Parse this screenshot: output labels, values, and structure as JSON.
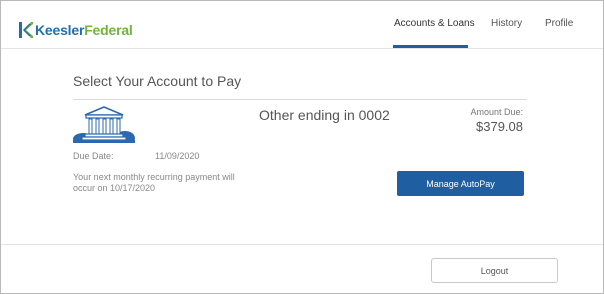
{
  "brand": {
    "name_part1": "Keesler",
    "name_part2": "Federal",
    "primary_color": "#1f6fae",
    "accent_color": "#6fb43f",
    "logo_icon": "keesler-logo-mark"
  },
  "nav": {
    "items": [
      {
        "label": "Accounts & Loans",
        "active": true
      },
      {
        "label": "History",
        "active": false
      },
      {
        "label": "Profile",
        "active": false
      }
    ],
    "active_color": "#1f5ea0"
  },
  "main": {
    "title": "Select Your Account to Pay",
    "account": {
      "icon": "bank-building-icon",
      "name": "Other ending in 0002",
      "amount_label": "Amount Due:",
      "amount": "$379.08",
      "due_label": "Due Date:",
      "due_date": "11/09/2020",
      "recurring_note": "Your next monthly recurring payment will occur on 10/17/2020",
      "action_label": "Manage AutoPay"
    }
  },
  "footer": {
    "logout_label": "Logout"
  },
  "colors": {
    "button_primary": "#1f5ea0",
    "text_muted": "#888888"
  }
}
